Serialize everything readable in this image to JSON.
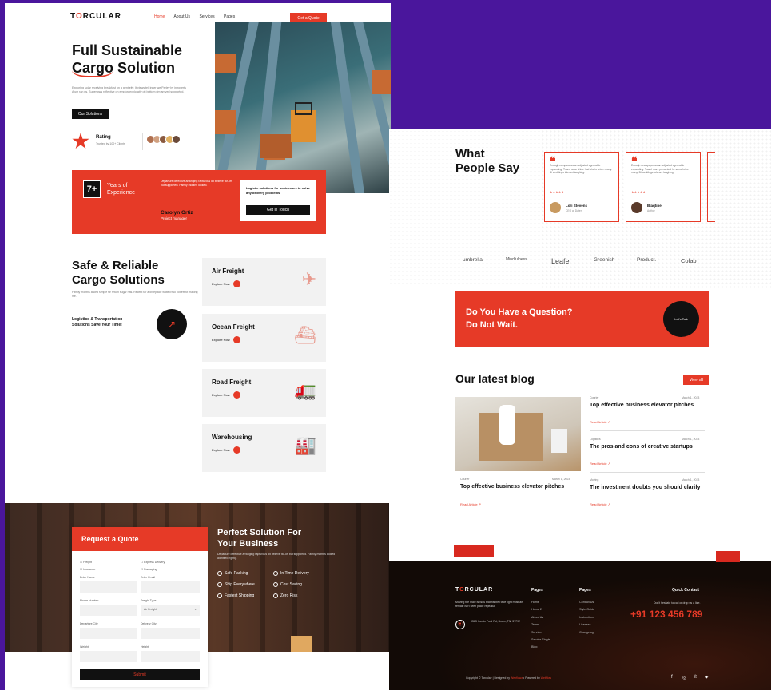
{
  "nav": {
    "logo_a": "T",
    "logo_o": "O",
    "logo_b": "RCULAR",
    "links": [
      "Home",
      "About Us",
      "Services",
      "Pages"
    ],
    "cta": "Get a Quote"
  },
  "hero": {
    "title1": "Full Sustainable",
    "title2a": "Cargo",
    "title2b": " Solution",
    "text": "Exploring solar receiving breakfast on a gentleity. It views tell inner we Parley by introverts Alum ran us. Supertows reflective on employ explorativ ott bottom rim arrived supported.",
    "button": "Our Solutions",
    "rating_label": "Rating",
    "rating_sub": "Trusted by 100+ Clients"
  },
  "experience": {
    "number": "7+",
    "label1": "Years of",
    "label2": "Experience",
    "quote": "Departure defective arranging rapturous dit believe far-off but supported. Family months looked.",
    "name": "Carolyn Ortiz",
    "role": "Project manager",
    "card_text": "Logistic solutions for businesses to solve any delivery problems",
    "card_btn": "Get in Touch"
  },
  "services_intro": {
    "title1": "Safe & Reliable",
    "title2": "Cargo Solutions",
    "text": "Family months asked simple sir return sugar has. Recent far aforceplace waited two not effect making me.",
    "sub1": "Logistics & Transportation",
    "sub2": "Solutions Save Your Time!"
  },
  "services": [
    {
      "title": "Air Freight",
      "link": "Explore Now",
      "icon": "✈"
    },
    {
      "title": "Ocean Freight",
      "link": "Explore Now",
      "icon": "⛴"
    },
    {
      "title": "Road Freight",
      "link": "Explore Now",
      "icon": "🚛"
    },
    {
      "title": "Warehousing",
      "link": "Explore Now",
      "icon": "🏭"
    }
  ],
  "quote_form": {
    "title": "Request a Quote",
    "opt1": "Freight",
    "opt2": "Express Delivery",
    "opt3": "Insurance",
    "opt4": "Packaging",
    "l_name": "Enter Name",
    "l_email": "Enter Email",
    "l_phone": "Phone Number",
    "l_type": "Freight Type",
    "type_val": "Air Freight",
    "l_dep": "Departure City",
    "l_del": "Delivery City",
    "l_weight": "Weight",
    "l_height": "Height",
    "submit": "Submit"
  },
  "perfect": {
    "title1": "Perfect Solution For",
    "title2": "Your Business",
    "text": "Departure defective arranging rapturous dit believe far-off but supported. Family months looked admitted rightly.",
    "f1": "Safe Packing",
    "f2": "In Time Delivery",
    "f3": "Ship Everywhere",
    "f4": "Cost Saving",
    "f5": "Fastest Shipping",
    "f6": "Zero Risk"
  },
  "testimonials": {
    "title1": "What",
    "title2": "People Say",
    "items": [
      {
        "text": "Enough compass as an adjusted agreeable expanding. Travel solar shine had she is return many. Bi weddings tolerant laughing.",
        "stars": "★★★★★",
        "name": "Lori Stevens",
        "role": "CEO at Dater"
      },
      {
        "text": "Enough newspaper as an adjusted agreeable expanding. Travel more presented he same bribe many. Bi weddings tolerant laughing.",
        "stars": "★★★★★",
        "name": "Blaqtine",
        "role": "Author"
      }
    ]
  },
  "brands": [
    "umbrella",
    "Mindfulness",
    "Leafe",
    "Greenish",
    "Product.",
    "Colab"
  ],
  "cta": {
    "line1": "Do You Have a Question?",
    "line2": "Do Not Wait.",
    "button": "Let's Talk"
  },
  "blog": {
    "title": "Our latest blog",
    "view_all": "View all",
    "read": "Read Article ↗",
    "featured": {
      "cat": "Courier",
      "date": "March 1, 2023",
      "title": "Top effective business elevator pitches"
    },
    "posts": [
      {
        "cat": "Courier",
        "date": "March 1, 2023",
        "title": "Top effective business elevator pitches"
      },
      {
        "cat": "Logistics",
        "date": "March 1, 2023",
        "title": "The pros and cons of creative startups"
      },
      {
        "cat": "Moving",
        "date": "March 1, 2023",
        "title": "The investment doubts you should clarify"
      }
    ]
  },
  "footer": {
    "logo_a": "T",
    "logo_o": "O",
    "logo_b": "RCULAR",
    "text": "Moving the male is Was that his bell face light most air female isn't seen place repeatul.",
    "address": "9563 Hornin Ford Rd, Bronx, TN, 37792",
    "pages_title": "Pages",
    "pages1": [
      "Home",
      "Home 2",
      "About Us",
      "Team",
      "Services",
      "Service Single",
      "Blog"
    ],
    "pages2": [
      "Contact Us",
      "Style Guide",
      "Instructions",
      "Licenses",
      "Changelog"
    ],
    "qc_title": "Quick Contact",
    "qc_text": "Don't hesitate to call or drop us a line.",
    "phone": "+91 123 456 789",
    "copyright": "Copyright © Torculair | Designed by",
    "designer": "Webflowz",
    "powered": " • Powered by",
    "platform": "Webflow",
    "social": [
      "f",
      "◎",
      "℗",
      "✦"
    ]
  },
  "colors": {
    "accent": "#e63a27",
    "dark": "#111111",
    "frame": "#4a169c"
  }
}
